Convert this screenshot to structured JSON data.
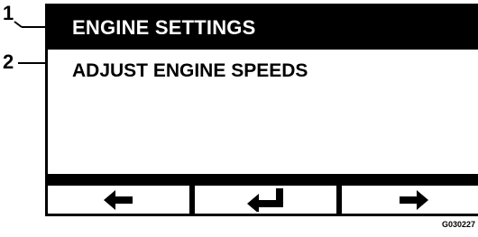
{
  "callouts": {
    "one": "1",
    "two": "2"
  },
  "screen": {
    "header_title": "ENGINE SETTINGS",
    "menu_item": "ADJUST ENGINE SPEEDS"
  },
  "softkeys": [
    {
      "icon": "left-arrow-icon"
    },
    {
      "icon": "enter-return-icon"
    },
    {
      "icon": "right-arrow-icon"
    }
  ],
  "figure_id": "G030227"
}
